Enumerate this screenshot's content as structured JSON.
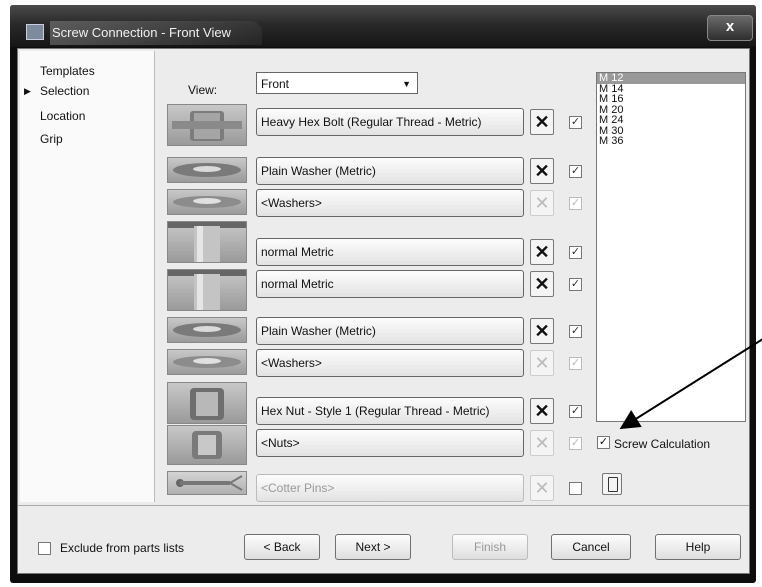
{
  "window": {
    "title": "Screw Connection - Front View",
    "close_glyph": "x"
  },
  "nav": {
    "items": [
      {
        "label": "Templates",
        "current": false
      },
      {
        "label": "Selection",
        "current": true
      },
      {
        "label": "Location",
        "current": false
      },
      {
        "label": "Grip",
        "current": false
      }
    ],
    "current_marker": "▶"
  },
  "view": {
    "label": "View:",
    "value": "Front"
  },
  "parts": [
    {
      "label": "Heavy Hex Bolt (Regular Thread - Metric)",
      "thumb": "bolt-thumbnail",
      "enabled": true,
      "checked": true
    },
    {
      "label": "Plain Washer (Metric)",
      "thumb": "washer-thumbnail",
      "enabled": true,
      "checked": true
    },
    {
      "label": "<Washers>",
      "thumb": "washer-thumbnail",
      "enabled": false,
      "checked": true
    },
    {
      "label": "normal Metric",
      "thumb": "hole-thumbnail",
      "enabled": true,
      "checked": true
    },
    {
      "label": "normal Metric",
      "thumb": "hole-thumbnail",
      "enabled": true,
      "checked": true
    },
    {
      "label": "Plain Washer (Metric)",
      "thumb": "washer-thumbnail",
      "enabled": true,
      "checked": true
    },
    {
      "label": "<Washers>",
      "thumb": "washer-thumbnail",
      "enabled": false,
      "checked": true
    },
    {
      "label": "Hex Nut - Style 1 (Regular Thread - Metric)",
      "thumb": "nut-thumbnail",
      "enabled": true,
      "checked": true
    },
    {
      "label": "<Nuts>",
      "thumb": "nut-thumbnail",
      "enabled": false,
      "checked": true
    },
    {
      "label": "<Cotter Pins>",
      "thumb": "cotter-pin-thumbnail",
      "enabled": false,
      "checked": false
    }
  ],
  "remove_glyph": "✕",
  "check_glyph": "✓",
  "sizes": {
    "items": [
      "M 12",
      "M 14",
      "M 16",
      "M 20",
      "M 24",
      "M 30",
      "M 36"
    ],
    "selected": "M 12"
  },
  "screw_calculation": {
    "label": "Screw Calculation",
    "checked": true
  },
  "exclude_from_parts_lists": {
    "label": "Exclude from parts lists",
    "checked": false
  },
  "buttons": {
    "back": "< Back",
    "next": "Next >",
    "finish": "Finish",
    "cancel": "Cancel",
    "help": "Help"
  }
}
